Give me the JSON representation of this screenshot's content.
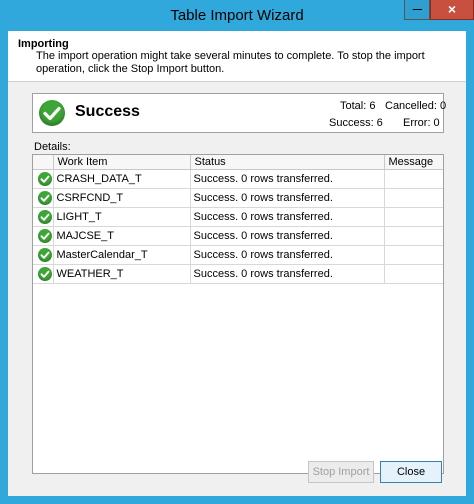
{
  "window": {
    "title": "Table Import Wizard",
    "close_glyph": "×"
  },
  "header": {
    "title": "Importing",
    "description": "The import operation might take several minutes to complete. To stop the import operation, click the Stop Import button."
  },
  "summary": {
    "status": "Success",
    "icon": "success-check-icon",
    "total_label": "Total: 6",
    "cancelled_label": "Cancelled: 0",
    "success_label": "Success: 6",
    "error_label": "Error: 0"
  },
  "details": {
    "label": "Details:",
    "columns": [
      "Work Item",
      "Status",
      "Message"
    ],
    "rows": [
      {
        "work_item": "CRASH_DATA_T",
        "status": "Success. 0 rows transferred.",
        "message": ""
      },
      {
        "work_item": "CSRFCND_T",
        "status": "Success. 0 rows transferred.",
        "message": ""
      },
      {
        "work_item": "LIGHT_T",
        "status": "Success. 0 rows transferred.",
        "message": ""
      },
      {
        "work_item": "MAJCSE_T",
        "status": "Success. 0 rows transferred.",
        "message": ""
      },
      {
        "work_item": "MasterCalendar_T",
        "status": "Success. 0 rows transferred.",
        "message": ""
      },
      {
        "work_item": "WEATHER_T",
        "status": "Success. 0 rows transferred.",
        "message": ""
      }
    ]
  },
  "buttons": {
    "stop_import": "Stop Import",
    "close": "Close"
  },
  "colors": {
    "titlebar": "#30a8dc",
    "close_button": "#c7503f",
    "success_green": "#3ea537"
  }
}
